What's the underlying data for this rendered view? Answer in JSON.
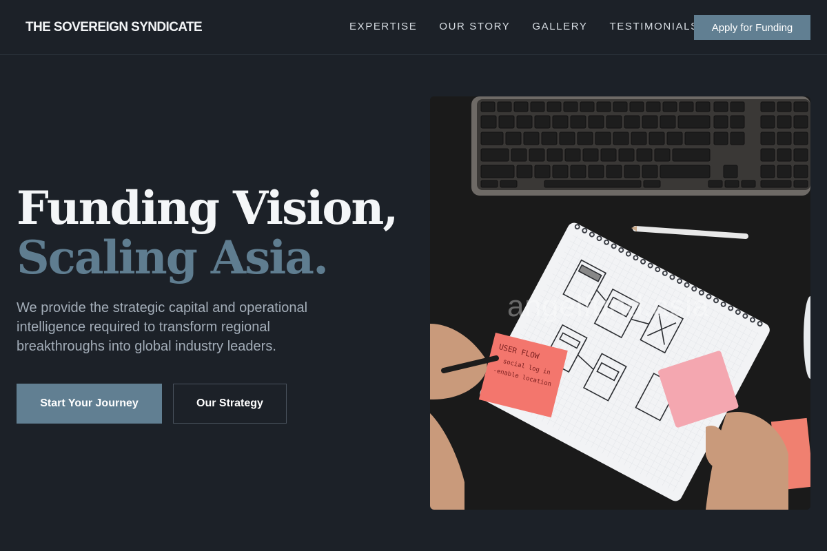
{
  "header": {
    "logo": "THE SOVEREIGN SYNDICATE",
    "nav": [
      {
        "label": "EXPERTISE"
      },
      {
        "label": "OUR STORY"
      },
      {
        "label": "GALLERY"
      },
      {
        "label": "TESTIMONIALS"
      }
    ],
    "cta_label": "Apply for Funding"
  },
  "hero": {
    "headline_line1": "Funding Vision,",
    "headline_line2": "Scaling Asia.",
    "description": "We provide the strategic capital and operational intelligence required to transform regional breakthroughs into global industry leaders.",
    "primary_button": "Start Your Journey",
    "secondary_button": "Our Strategy"
  },
  "image": {
    "watermark": "angelfund.asia",
    "sticky_note_text": "USER FLOW\n- social log in\n-enable location"
  },
  "colors": {
    "background": "#1c2128",
    "accent": "#617f92",
    "headline_accent": "#5f7d90",
    "text_muted": "#a3adb8"
  }
}
